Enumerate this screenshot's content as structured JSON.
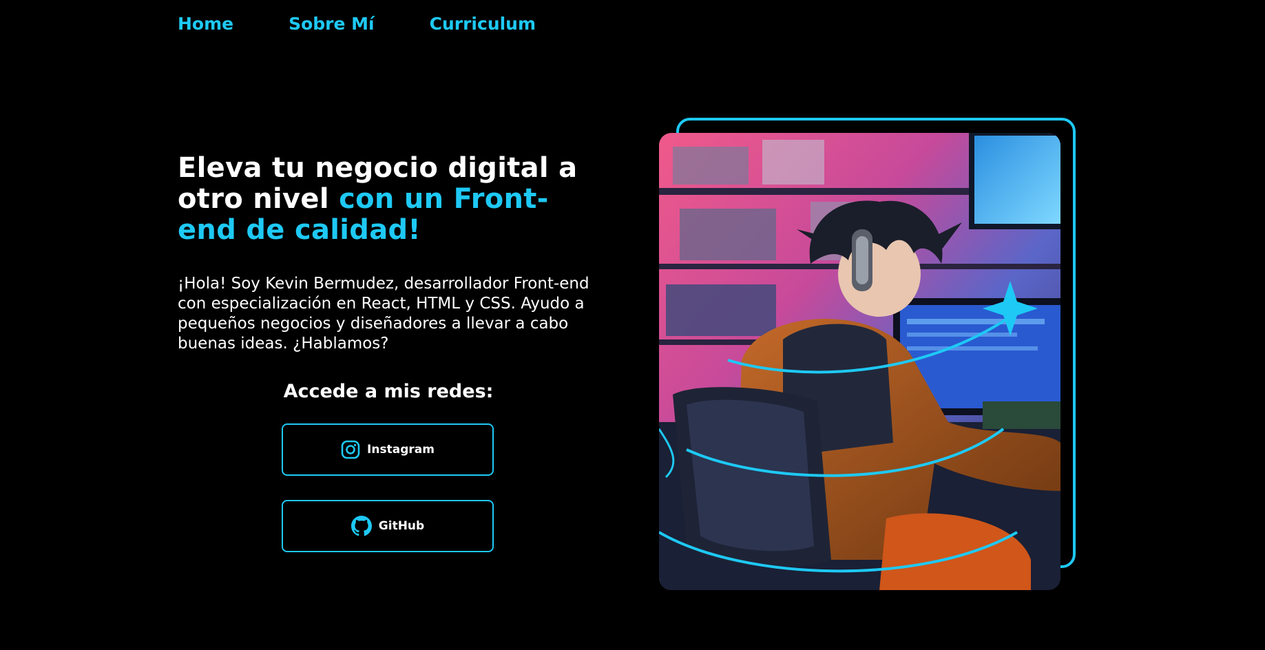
{
  "nav": {
    "items": [
      {
        "label": "Home"
      },
      {
        "label": "Sobre Mí"
      },
      {
        "label": "Curriculum"
      }
    ]
  },
  "hero": {
    "title_white": "Eleva tu negocio digital a otro nivel ",
    "title_accent": "con un Front-end de calidad!",
    "description": "¡Hola! Soy Kevin Bermudez, desarrollador Front-end con especialización en React, HTML y CSS. Ayudo a pequeños negocios y diseñadores a llevar a cabo buenas ideas. ¿Hablamos?"
  },
  "social": {
    "heading": "Accede a mis redes:",
    "instagram_label": "Instagram",
    "github_label": "GitHub"
  },
  "illustration": {
    "icon": "anime-developer-illustration"
  },
  "colors": {
    "accent": "#1ec9f5",
    "background": "#000000",
    "text": "#ffffff"
  }
}
